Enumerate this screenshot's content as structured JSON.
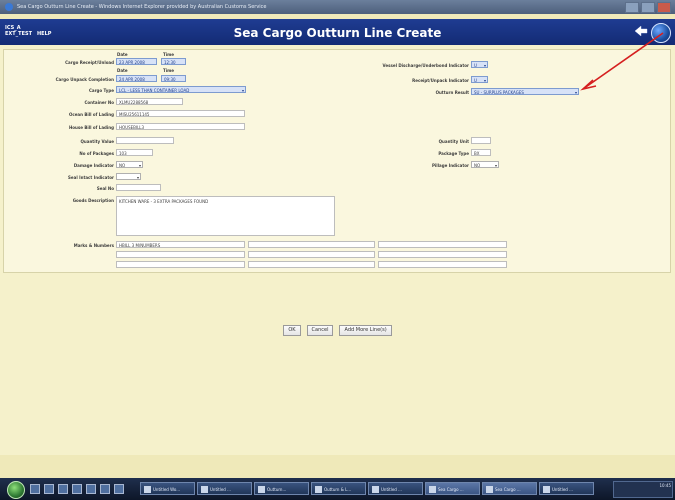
{
  "window": {
    "title": "Sea Cargo Outturn Line Create - Windows Internet Explorer provided by Australian Customs Service"
  },
  "header": {
    "app_line1": "ICS_A",
    "app_line2": "EXT_TEST",
    "help_label": "HELP",
    "page_title": "Sea Cargo Outturn Line Create",
    "back_icon": "back-arrow-icon",
    "globe_icon": "globe-icon"
  },
  "form": {
    "cargo_receipt_unload": {
      "label": "Cargo Receipt/Unload",
      "date_label": "Date",
      "time_label": "Time",
      "date": "23 APR 2008",
      "time": "12:30"
    },
    "cargo_unpack_completion": {
      "label": "Cargo Unpack Completion",
      "date_label": "Date",
      "time_label": "Time",
      "date": "24 APR 2008",
      "time": "09:30"
    },
    "cargo_type": {
      "label": "Cargo Type",
      "value": "LCL - LESS THAN CONTAINER LOAD"
    },
    "container_no": {
      "label": "Container No",
      "value": "XLMU2288568"
    },
    "ocean_bill": {
      "label": "Ocean Bill of Lading",
      "value": "MISU25611145"
    },
    "house_bill": {
      "label": "House Bill of Lading",
      "value": "HOUSEBILL3"
    },
    "quantity_value": {
      "label": "Quantity Value",
      "value": ""
    },
    "no_of_packages": {
      "label": "No of Packages",
      "value": "103"
    },
    "damage_indicator": {
      "label": "Damage Indicator",
      "value": "NO"
    },
    "seal_intact_indicator": {
      "label": "Seal Intact Indicator",
      "value": ""
    },
    "seal_no": {
      "label": "Seal No",
      "value": ""
    },
    "goods_description": {
      "label": "Goods Description",
      "value": "KITCHEN WARE - 3 EXTRA PACKAGES FOUND"
    },
    "marks_numbers": {
      "label": "Marks & Numbers",
      "value": "HBILL 3 M/NUMBERS"
    },
    "vessel_discharge_indicator": {
      "label": "Vessel Discharge/Underbond Indicator",
      "value": "U"
    },
    "receipt_unpack_indicator": {
      "label": "Receipt/Unpack Indicator",
      "value": "U"
    },
    "outturn_result": {
      "label": "Outturn Result",
      "value": "SU - SURPLUS PACKAGES"
    },
    "quantity_unit": {
      "label": "Quantity Unit",
      "value": ""
    },
    "package_type": {
      "label": "Package Type",
      "value": "BX"
    },
    "pillage_indicator": {
      "label": "Pillage Indicator",
      "value": "NO"
    }
  },
  "buttons": {
    "ok": "OK",
    "cancel": "Cancel",
    "add_more": "Add More Line(s)"
  },
  "taskbar": {
    "tasks": [
      "Untitled Wo...",
      "Untitled ...",
      "Outturn...",
      "Outturn & L...",
      "Untitled ...",
      "Sea Cargo ...",
      "Sea Cargo ...",
      "Untitled ..."
    ],
    "clock": "10:45"
  },
  "colors": {
    "header_blue": "#1f3c92",
    "background": "#f5f1cb",
    "annotation_red": "#d51f1f"
  }
}
